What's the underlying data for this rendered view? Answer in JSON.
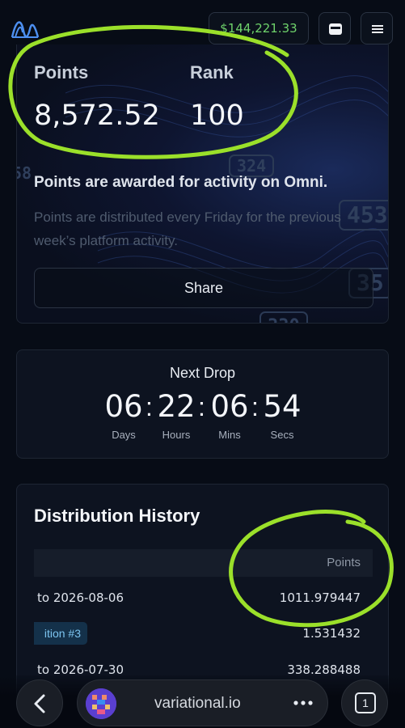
{
  "header": {
    "balance": "$144,221.33",
    "logo_icon": "variational-logo-icon",
    "wallet_icon": "wallet-icon",
    "menu_icon": "hamburger-menu-icon"
  },
  "points_card": {
    "points_label": "Points",
    "points_value": "8,572.52",
    "rank_label": "Rank",
    "rank_value": "100",
    "awarded_text": "Points are awarded for activity on Omni.",
    "distributed_text": "Points are distributed every Friday for the previous week’s platform activity.",
    "share_label": "Share",
    "background_numbers": [
      "324",
      "58",
      "453",
      "35",
      "330"
    ]
  },
  "countdown": {
    "title": "Next Drop",
    "units": [
      {
        "value": "06",
        "label": "Days"
      },
      {
        "value": "22",
        "label": "Hours"
      },
      {
        "value": "06",
        "label": "Mins"
      },
      {
        "value": "54",
        "label": "Secs"
      }
    ],
    "separator": ":"
  },
  "history": {
    "title": "Distribution History",
    "column_points": "Points",
    "rows": [
      {
        "left": "to  2026-08-06",
        "points": "1011.979447"
      },
      {
        "badge": "ition #3",
        "points": "1.531432"
      },
      {
        "left": "to  2026-07-30",
        "points": "338.288488"
      }
    ]
  },
  "browser": {
    "url": "variational.io",
    "tab_count": "1",
    "back_icon": "chevron-left-icon",
    "more_icon": "more-dots-icon"
  },
  "colors": {
    "accent_green": "#6fd36b",
    "annotation_green": "#9be02a",
    "badge_blue": "#7cc4f0"
  }
}
